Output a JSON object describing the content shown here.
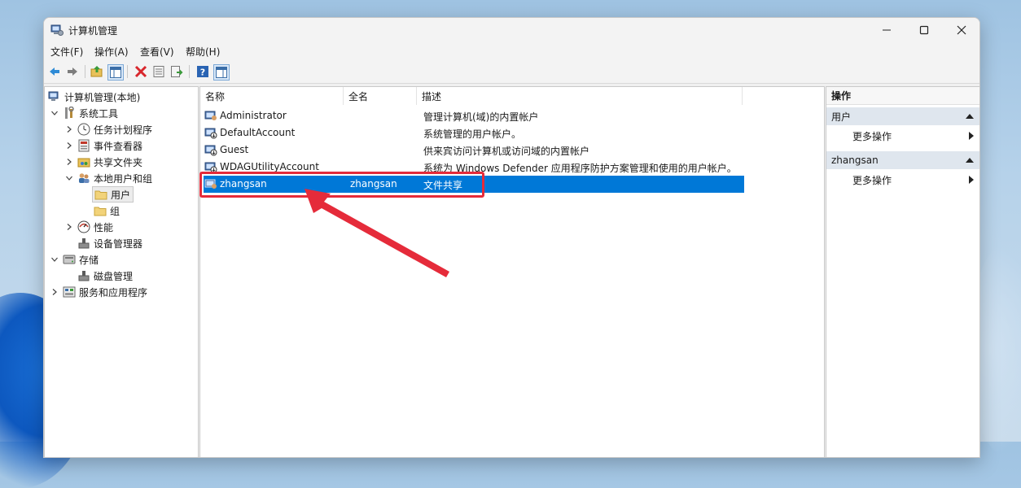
{
  "window": {
    "title": "计算机管理",
    "icon": "computer-management-icon"
  },
  "menu": [
    "文件(F)",
    "操作(A)",
    "查看(V)",
    "帮助(H)"
  ],
  "toolbar_icons": [
    "back-arrow-icon",
    "forward-arrow-icon",
    "up-folder-icon",
    "show-hide-tree-icon",
    "delete-icon",
    "properties-icon",
    "export-list-icon",
    "help-icon",
    "show-hide-action-pane-icon"
  ],
  "tree": [
    {
      "label": "计算机管理(本地)",
      "icon": "computer-management-icon",
      "level": 0,
      "expanded": null
    },
    {
      "label": "系统工具",
      "icon": "tools-icon",
      "level": 1,
      "expanded": true
    },
    {
      "label": "任务计划程序",
      "icon": "clock-icon",
      "level": 2,
      "expanded": false
    },
    {
      "label": "事件查看器",
      "icon": "event-viewer-icon",
      "level": 2,
      "expanded": false
    },
    {
      "label": "共享文件夹",
      "icon": "shared-folder-icon",
      "level": 2,
      "expanded": false
    },
    {
      "label": "本地用户和组",
      "icon": "users-groups-icon",
      "level": 2,
      "expanded": true
    },
    {
      "label": "用户",
      "icon": "folder-icon",
      "level": 3,
      "expanded": null,
      "selected": true
    },
    {
      "label": "组",
      "icon": "folder-icon",
      "level": 3,
      "expanded": null
    },
    {
      "label": "性能",
      "icon": "performance-icon",
      "level": 2,
      "expanded": false
    },
    {
      "label": "设备管理器",
      "icon": "device-manager-icon",
      "level": 2,
      "expanded": null
    },
    {
      "label": "存储",
      "icon": "storage-icon",
      "level": 1,
      "expanded": true
    },
    {
      "label": "磁盘管理",
      "icon": "disk-management-icon",
      "level": 2,
      "expanded": null
    },
    {
      "label": "服务和应用程序",
      "icon": "services-icon",
      "level": 1,
      "expanded": false
    }
  ],
  "list": {
    "columns": [
      "名称",
      "全名",
      "描述"
    ],
    "rows": [
      {
        "name": "Administrator",
        "fullname": "",
        "desc": "管理计算机(域)的内置帐户",
        "icon": "user-icon"
      },
      {
        "name": "DefaultAccount",
        "fullname": "",
        "desc": "系统管理的用户帐户。",
        "icon": "disabled-user-icon"
      },
      {
        "name": "Guest",
        "fullname": "",
        "desc": "供来宾访问计算机或访问域的内置帐户",
        "icon": "disabled-user-icon"
      },
      {
        "name": "WDAGUtilityAccount",
        "fullname": "",
        "desc": "系统为 Windows Defender 应用程序防护方案管理和使用的用户帐户。",
        "icon": "disabled-user-icon"
      },
      {
        "name": "zhangsan",
        "fullname": "zhangsan",
        "desc": "文件共享",
        "icon": "user-icon",
        "selected": true
      }
    ]
  },
  "actions": {
    "header": "操作",
    "sections": [
      {
        "title": "用户",
        "item": "更多操作"
      },
      {
        "title": "zhangsan",
        "item": "更多操作"
      }
    ]
  },
  "colors": {
    "selection": "#0078d7",
    "annotation": "#e52b3a"
  }
}
